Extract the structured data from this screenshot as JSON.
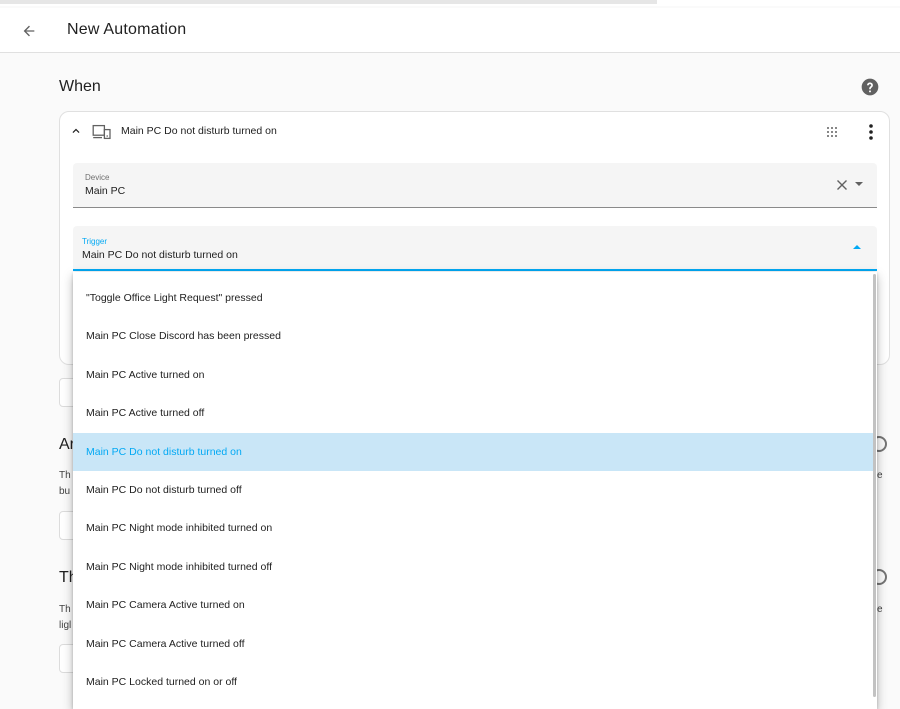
{
  "header": {
    "title": "New Automation",
    "back_icon": "arrow-left-icon"
  },
  "section": {
    "title": "When",
    "help_icon": "help-circle-icon"
  },
  "trigger_card": {
    "title": "Main PC Do not disturb turned on",
    "icons": [
      "chevron-up-icon",
      "devices-icon",
      "drag-handle-icon",
      "more-vertical-icon"
    ]
  },
  "device_field": {
    "label": "Device",
    "value": "Main PC"
  },
  "trigger_field": {
    "label": "Trigger",
    "value": "Main PC Do not disturb turned on"
  },
  "background_fragments": {
    "and_heading": "Ar",
    "and_line1": "Th",
    "and_line2": "bu",
    "and_right": "e",
    "then_heading": "Th",
    "then_line1": "Th",
    "then_line2": "ligl",
    "then_right": "e"
  },
  "dropdown": {
    "selected_index": 4,
    "options": [
      "\"Toggle Office Light Request\" pressed",
      "Main PC Close Discord has been pressed",
      "Main PC Active turned on",
      "Main PC Active turned off",
      "Main PC Do not disturb turned on",
      "Main PC Do not disturb turned off",
      "Main PC Night mode inhibited turned on",
      "Main PC Night mode inhibited turned off",
      "Main PC Camera Active turned on",
      "Main PC Camera Active turned off",
      "Main PC Locked turned on or off"
    ]
  },
  "colors": {
    "accent": "#03a9f4",
    "selected_bg": "#c9e6f7",
    "background": "#fafafa"
  }
}
